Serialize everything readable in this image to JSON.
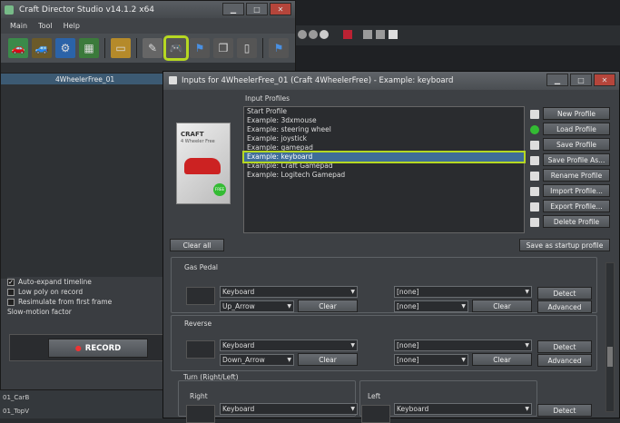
{
  "main": {
    "title": "Craft Director Studio v14.1.2 x64",
    "menu": [
      "Main",
      "Tool",
      "Help"
    ],
    "tree_item": "4WheelerFree_01",
    "options": {
      "auto_expand": "Auto-expand timeline",
      "low_poly": "Low poly on record",
      "resimulate": "Resimulate from first frame",
      "slowmo": "Slow-motion factor"
    },
    "record": "RECORD"
  },
  "viewport": {
    "label1": "01_CarB",
    "label2": "01_TopV"
  },
  "dialog": {
    "title": "Inputs for 4WheelerFree_01 (Craft 4WheelerFree) - Example: keyboard",
    "profiles_label": "Input Profiles",
    "profiles": [
      "Start Profile",
      "Example: 3dxmouse",
      "Example: steering wheel",
      "Example: joystick",
      "Example: gamepad",
      "Example: keyboard",
      "Example: Craft Gamepad",
      "Example: Logitech Gamepad"
    ],
    "selected_profile_index": 5,
    "buttons": {
      "new": "New Profile",
      "load": "Load Profile",
      "save": "Save Profile",
      "save_as": "Save Profile As...",
      "rename": "Rename Profile",
      "import": "Import Profile...",
      "export": "Export Profile...",
      "delete": "Delete Profile",
      "clear_all": "Clear all",
      "startup": "Save as startup profile"
    },
    "box": {
      "brand": "CRAFT",
      "product": "4 Wheeler Free",
      "badge": "FREE"
    },
    "gas": {
      "title": "Gas Pedal",
      "dev1": "Keyboard",
      "key1": "Up_Arrow",
      "dev2": "[none]",
      "key2": "[none]",
      "clear": "Clear",
      "detect": "Detect",
      "advanced": "Advanced"
    },
    "reverse": {
      "title": "Reverse",
      "dev1": "Keyboard",
      "key1": "Down_Arrow",
      "dev2": "[none]",
      "key2": "[none]",
      "clear": "Clear",
      "detect": "Detect",
      "advanced": "Advanced"
    },
    "turn": {
      "title": "Turn (Right/Left)",
      "right": "Right",
      "left": "Left",
      "dev1": "Keyboard",
      "dev2": "Keyboard",
      "detect": "Detect"
    }
  }
}
